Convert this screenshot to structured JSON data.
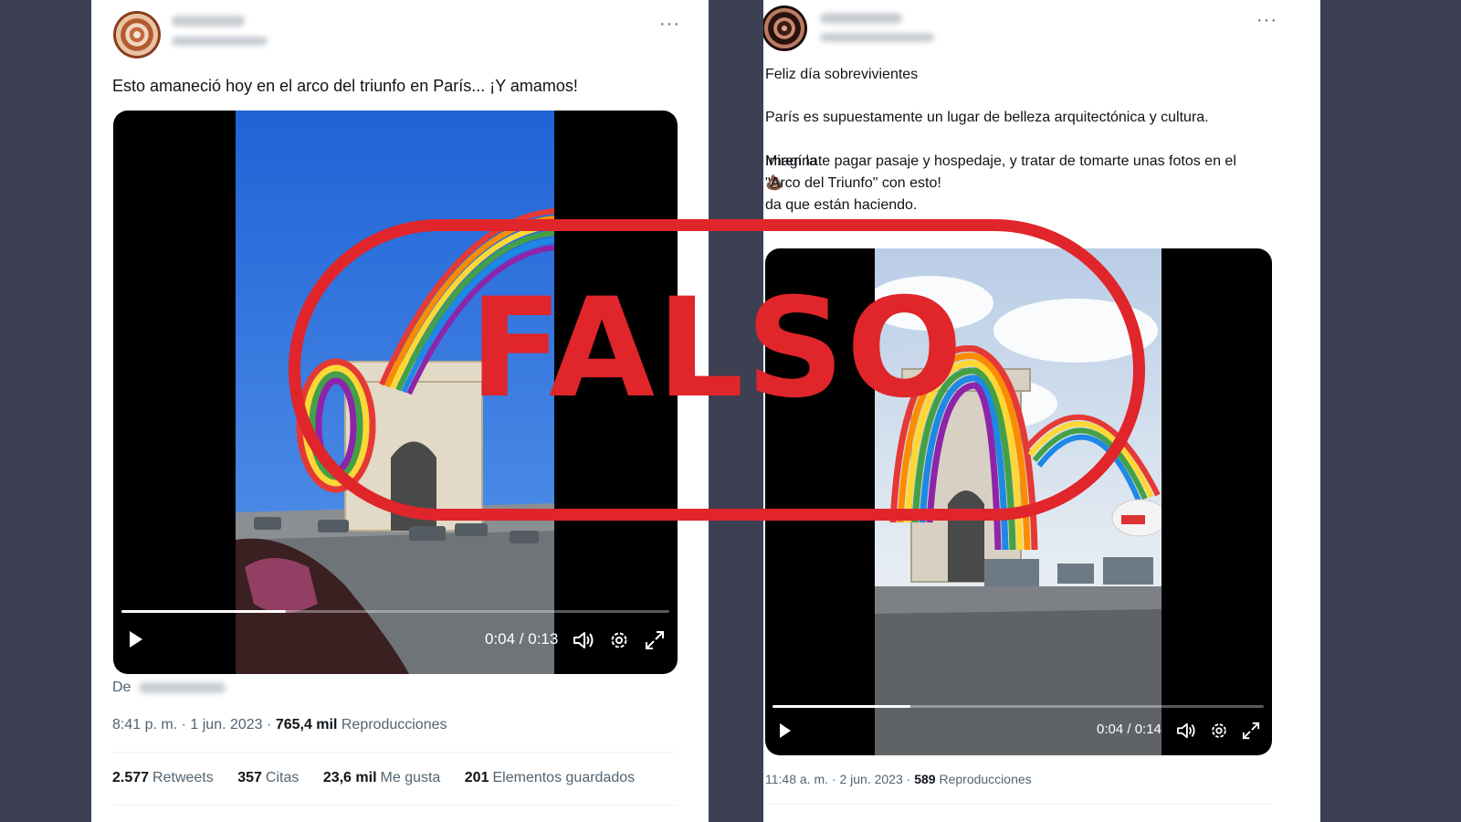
{
  "left_post": {
    "text": "Esto amaneció hoy en el arco del triunfo en París... ¡Y amamos!",
    "video": {
      "time": "0:04 / 0:13",
      "progress": 0.3
    },
    "source_prefix": "De",
    "meta": {
      "time": "8:41 p. m.",
      "separator": "·",
      "date": "1 jun. 2023",
      "views_value": "765,4 mil",
      "views_label": "Reproducciones"
    },
    "stats": [
      {
        "value": "2.577",
        "label": "Retweets"
      },
      {
        "value": "357",
        "label": "Citas"
      },
      {
        "value": "23,6 mil",
        "label": "Me gusta"
      },
      {
        "value": "201",
        "label": "Elementos guardados"
      }
    ]
  },
  "right_post": {
    "text_line1": "Feliz día sobrevivientes",
    "text_line2": "París es supuestamente un lugar de belleza arquitectónica y cultura.",
    "text_line3_a": "Miren la",
    "text_line3_emoji": "💩",
    "text_line3_b": "da que están haciendo.",
    "text_line4": "Imagínate pagar pasaje y hospedaje, y tratar de tomarte unas fotos en el",
    "text_line5": "\"Arco del Triunfo\" con esto!",
    "video": {
      "time": "0:04 / 0:14",
      "progress": 0.28
    },
    "meta": {
      "time": "11:48 a. m.",
      "separator": "·",
      "date": "2 jun. 2023",
      "views_value": "589",
      "views_label": "Reproducciones"
    }
  },
  "stamp": {
    "text": "FALSO",
    "color": "#e0252b"
  },
  "icons": {
    "more": "more-icon",
    "play": "play-icon",
    "volume": "volume-icon",
    "settings": "gear-icon",
    "fullscreen": "fullscreen-icon"
  },
  "more_glyph": "···"
}
